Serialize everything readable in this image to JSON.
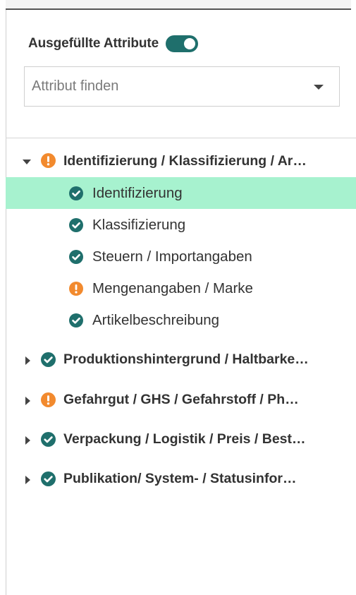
{
  "filter": {
    "toggle_label": "Ausgefüllte Attribute",
    "toggle_on": true,
    "search_placeholder": "Attribut finden"
  },
  "colors": {
    "accent": "#1f6f6c",
    "warning": "#f28a2e",
    "selected_row": "#a7f2cf"
  },
  "tree": {
    "groups": [
      {
        "label": "Identifizierung / Klassifizierung / Ar…",
        "status": "warning",
        "expanded": true,
        "children": [
          {
            "label": "Identifizierung",
            "status": "ok",
            "selected": true
          },
          {
            "label": "Klassifizierung",
            "status": "ok"
          },
          {
            "label": "Steuern / Importangaben",
            "status": "ok"
          },
          {
            "label": "Mengenangaben / Marke",
            "status": "warning"
          },
          {
            "label": "Artikelbeschreibung",
            "status": "ok"
          }
        ]
      },
      {
        "label": "Produktionshintergrund / Haltbarke…",
        "status": "ok",
        "expanded": false
      },
      {
        "label": "Gefahrgut / GHS / Gefahrstoff / Ph…",
        "status": "warning",
        "expanded": false
      },
      {
        "label": "Verpackung / Logistik / Preis / Best…",
        "status": "ok",
        "expanded": false
      },
      {
        "label": "Publikation/ System- / Statusinfor…",
        "status": "ok",
        "expanded": false
      }
    ]
  }
}
